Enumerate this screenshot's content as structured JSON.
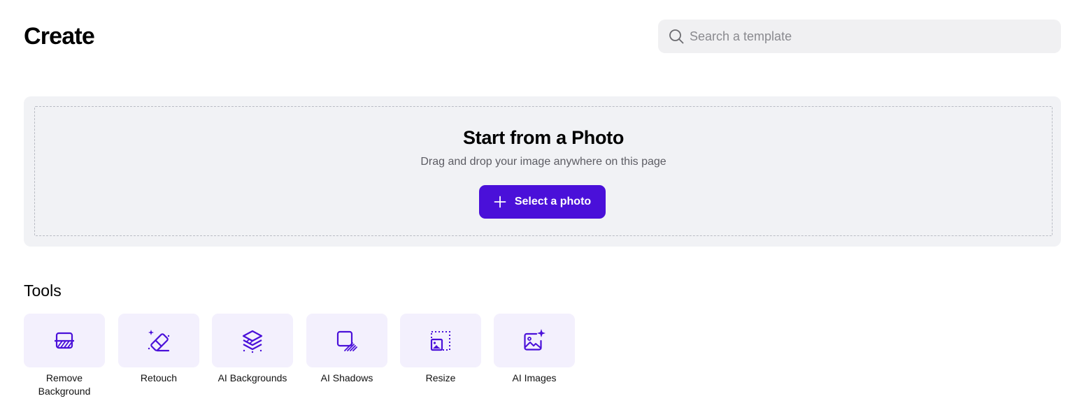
{
  "header": {
    "title": "Create"
  },
  "search": {
    "placeholder": "Search a template",
    "value": "",
    "icon": "search-icon"
  },
  "upload": {
    "title": "Start from a Photo",
    "subtitle": "Drag and drop your image anywhere on this page",
    "button_label": "Select a photo",
    "button_icon": "plus-icon"
  },
  "tools": {
    "heading": "Tools",
    "items": [
      {
        "label": "Remove Background",
        "icon": "remove-background-icon"
      },
      {
        "label": "Retouch",
        "icon": "eraser-icon"
      },
      {
        "label": "AI Backgrounds",
        "icon": "layers-sparkle-icon"
      },
      {
        "label": "AI Shadows",
        "icon": "shadow-square-icon"
      },
      {
        "label": "Resize",
        "icon": "resize-icon"
      },
      {
        "label": "AI Images",
        "icon": "image-sparkle-icon"
      }
    ]
  },
  "colors": {
    "accent": "#4a10d9",
    "panel_bg": "#f1f2f5",
    "tool_tile_bg": "#f3f0fd",
    "search_bg": "#f0f0f2"
  }
}
